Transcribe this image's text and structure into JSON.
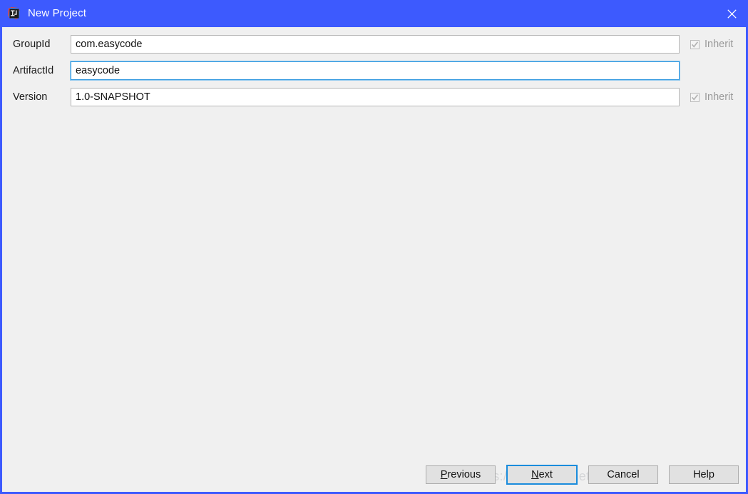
{
  "window": {
    "title": "New Project",
    "icon": "intellij-idea-logo-icon",
    "close_icon": "close-icon",
    "titlebar_color": "#3d5afe",
    "background_color": "#f0f0f0"
  },
  "form": {
    "rows": [
      {
        "label": "GroupId",
        "value": "com.easycode",
        "placeholder": "",
        "focused": false,
        "inherit": {
          "label": "Inherit",
          "checked": true,
          "enabled": false
        }
      },
      {
        "label": "ArtifactId",
        "value": "easycode",
        "placeholder": "",
        "focused": true,
        "inherit": null
      },
      {
        "label": "Version",
        "value": "1.0-SNAPSHOT",
        "placeholder": "",
        "focused": false,
        "inherit": {
          "label": "Inherit",
          "checked": true,
          "enabled": false
        }
      }
    ]
  },
  "buttons": [
    {
      "label": "Previous",
      "mnemonic": "P",
      "focused": false
    },
    {
      "label": "Next",
      "mnemonic": "N",
      "focused": true
    },
    {
      "label": "Cancel",
      "mnemonic": "",
      "focused": false
    },
    {
      "label": "Help",
      "mnemonic": "",
      "focused": false
    }
  ],
  "watermark": {
    "text": "https://blog.csdn.net/jokerdj233"
  },
  "colors": {
    "accent_blue": "#3d5afe",
    "focus_blue": "#1a8cdc",
    "field_border": "#b6b6b6",
    "disabled_text": "#9a9a9a"
  }
}
